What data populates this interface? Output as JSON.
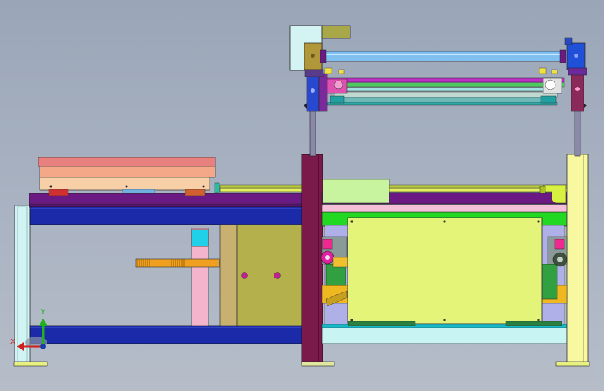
{
  "viewport": {
    "axis_labels": {
      "x": "X",
      "y": "Y"
    }
  },
  "colors": {
    "background": "#a6b0bf",
    "pale_cyan": "#c8f0f0",
    "navy": "#1a2aa8",
    "purple": "#6a1a82",
    "magenta": "#b0208a",
    "maroon": "#7a1a4a",
    "tan": "#c8b070",
    "olive": "#a8a848",
    "yellow_green": "#e0f070",
    "light_yellow": "#f8f8a0",
    "pink": "#f0b0c8",
    "salmon": "#f0a080",
    "orange": "#f0a020",
    "green": "#18c818",
    "cyan": "#20d0e8",
    "steel_blue": "#70b0e0",
    "lavender": "#b0b0e8"
  }
}
